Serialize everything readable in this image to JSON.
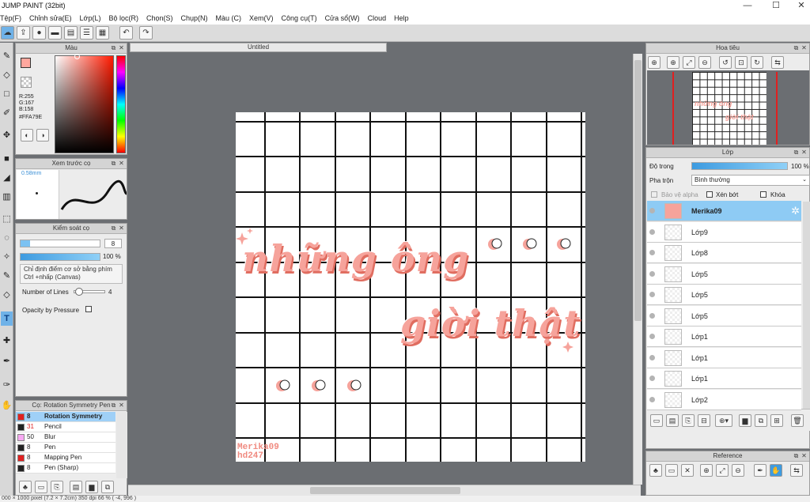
{
  "app": {
    "title": "JUMP PAINT (32bit)"
  },
  "window_controls": {
    "minimize": "—",
    "maximize": "☐",
    "close": "✕"
  },
  "menu": [
    "Tệp(F)",
    "Chỉnh sửa(E)",
    "Lớp(L)",
    "Bộ lọc(R)",
    "Chọn(S)",
    "Chụp(N)",
    "Màu (C)",
    "Xem(V)",
    "Công cụ(T)",
    "Cửa sổ(W)",
    "Cloud",
    "Help"
  ],
  "canvas_tab": "Untitled",
  "panels": {
    "color": {
      "title": "Màu",
      "r": "R:255",
      "g": "G:167",
      "b": "B:158",
      "hex": "#FFA79E",
      "fg": "#ffa79e"
    },
    "preview": {
      "title": "Xem trước cọ",
      "size": "0.58mm"
    },
    "brush_control": {
      "title": "Kiểm soát cọ",
      "size_value": "8",
      "opacity_value": "100 %",
      "hint": "Chỉ định điểm cơ sở bằng phím Ctrl +nhấp (Canvas)",
      "lines_label": "Number of Lines",
      "lines_value": "4",
      "pressure_label": "Opacity by Pressure"
    },
    "brushes": {
      "title": "Cọ: Rotation Symmetry Pen",
      "items": [
        {
          "size": "8",
          "name": "Rotation Symmetry",
          "color": "#e02020",
          "selected": true
        },
        {
          "size": "31",
          "name": "Pencil",
          "color": "#222222",
          "selected": false
        },
        {
          "size": "50",
          "name": "Blur",
          "color": "#f7a8f2",
          "selected": false
        },
        {
          "size": "8",
          "name": "Pen",
          "color": "#222222",
          "selected": false
        },
        {
          "size": "8",
          "name": "Mapping Pen",
          "color": "#e02020",
          "selected": false
        },
        {
          "size": "8",
          "name": "Pen (Sharp)",
          "color": "#222222",
          "selected": false
        }
      ]
    },
    "navigator": {
      "title": "Hoa tiêu"
    },
    "layers": {
      "title": "Lớp",
      "opacity_label": "Độ trong",
      "opacity_value": "100 %",
      "blend_label": "Pha trộn",
      "blend_value": "Bình thường",
      "protect_alpha": "Bảo vệ alpha",
      "clipping": "Xén bớt",
      "lock": "Khóa",
      "items": [
        "Merika09",
        "Lớp9",
        "Lớp8",
        "Lớp5",
        "Lớp5",
        "Lớp5",
        "Lớp1",
        "Lớp1",
        "Lớp1",
        "Lớp2"
      ]
    },
    "reference": {
      "title": "Reference"
    }
  },
  "canvas": {
    "text_line1": "những ông",
    "text_line2": "giời thật",
    "signature_1": "Merika09",
    "signature_2": "hd247",
    "text_color": "#f6a39b"
  },
  "status": "000 × 1000 pixel   (7.2 × 7.2cm)   350 dpi   66 %   ( -4, 996 )"
}
